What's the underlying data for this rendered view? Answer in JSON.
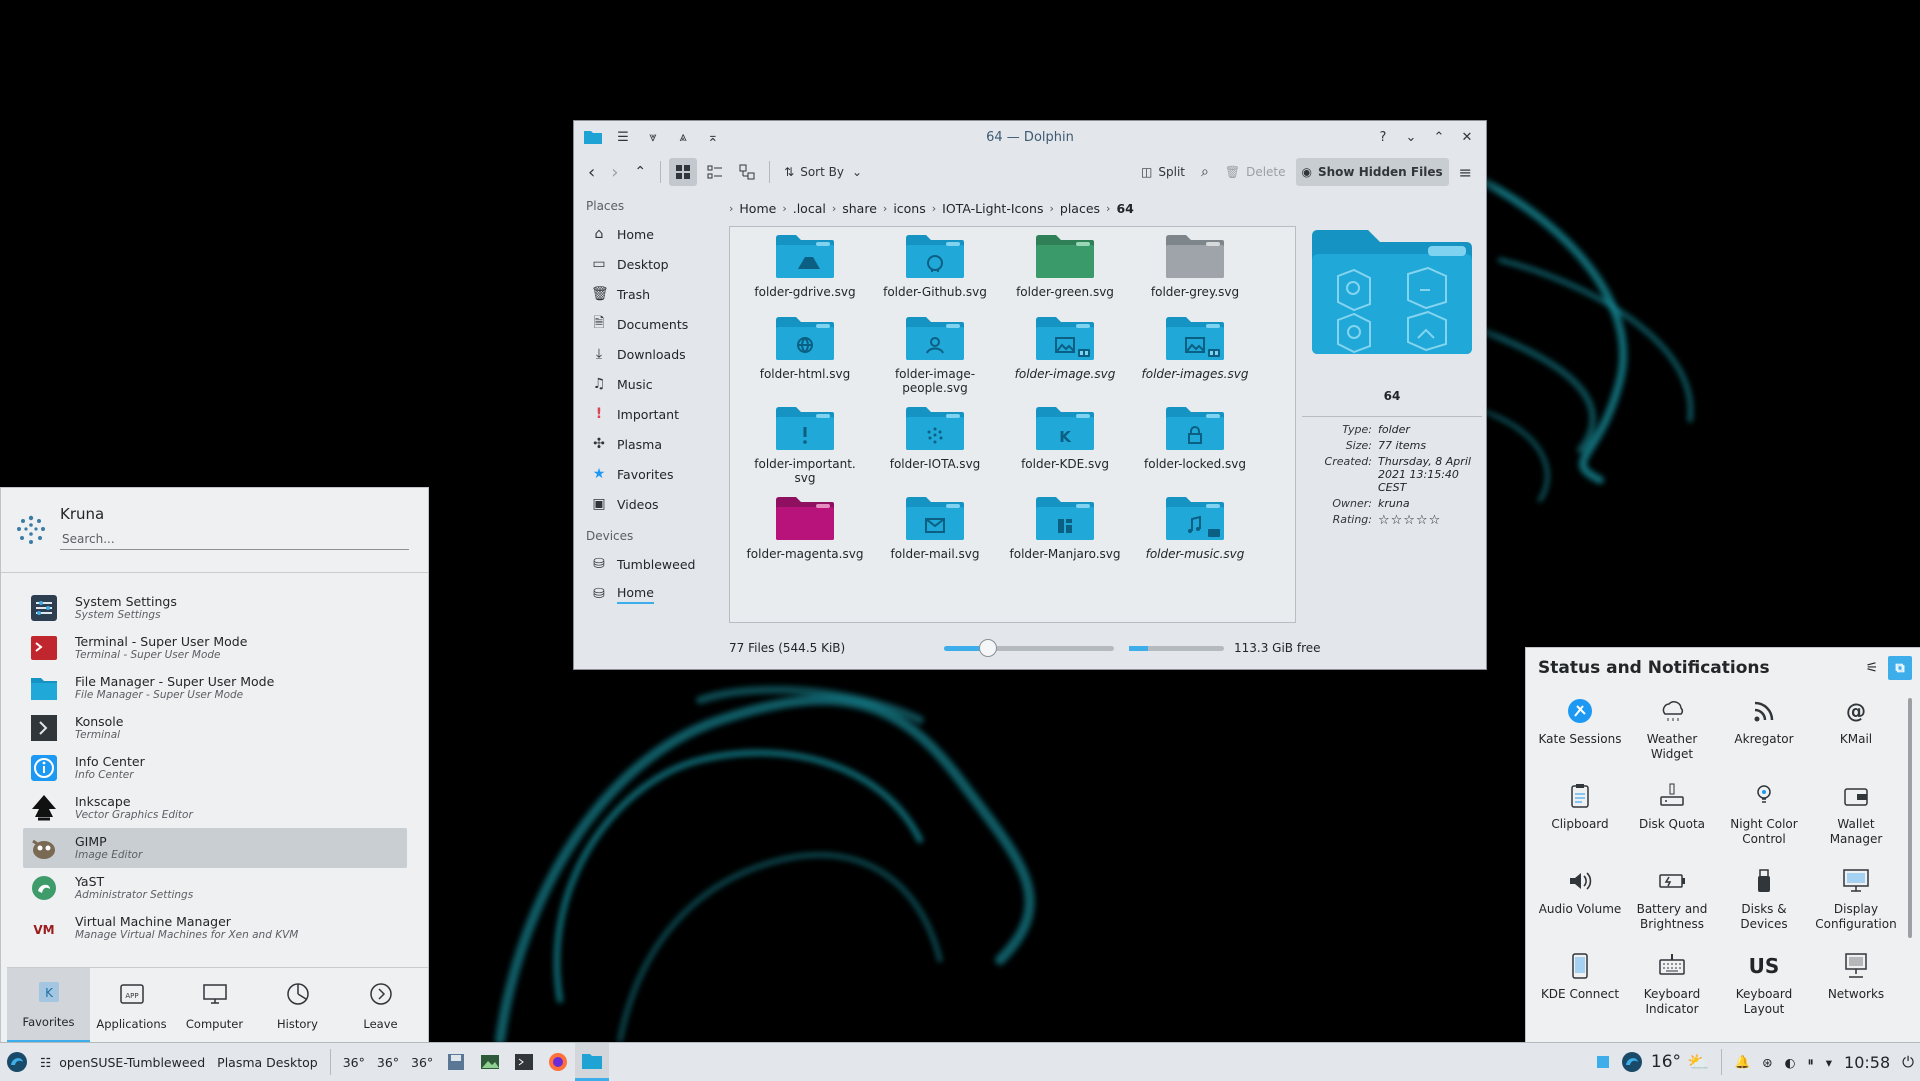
{
  "colors": {
    "accent": "#3daee9",
    "folder_blue": "#1fa3d4",
    "folder_green": "#3a9a6a",
    "folder_grey": "#9ea4aa",
    "folder_magenta": "#b8137b"
  },
  "dolphin": {
    "title": "64 — Dolphin",
    "toolbar": {
      "sort_by": "Sort By",
      "split": "Split",
      "delete": "Delete",
      "show_hidden": "Show Hidden Files"
    },
    "places_header": "Places",
    "places": [
      {
        "label": "Home",
        "icon": "home-icon"
      },
      {
        "label": "Desktop",
        "icon": "desktop-icon"
      },
      {
        "label": "Trash",
        "icon": "trash-icon"
      },
      {
        "label": "Documents",
        "icon": "documents-icon"
      },
      {
        "label": "Downloads",
        "icon": "downloads-icon"
      },
      {
        "label": "Music",
        "icon": "music-icon"
      },
      {
        "label": "Important",
        "icon": "important-icon"
      },
      {
        "label": "Plasma",
        "icon": "plasma-icon"
      },
      {
        "label": "Favorites",
        "icon": "star-icon"
      },
      {
        "label": "Videos",
        "icon": "videos-icon"
      }
    ],
    "devices_header": "Devices",
    "devices": [
      {
        "label": "Tumbleweed",
        "icon": "drive-icon"
      },
      {
        "label": "Home",
        "icon": "drive-icon"
      }
    ],
    "breadcrumb": [
      "Home",
      ".local",
      "share",
      "icons",
      "IOTA-Light-Icons",
      "places",
      "64"
    ],
    "files": [
      {
        "name": "folder-gdrive.svg",
        "italic": false,
        "color": "blue",
        "glyph": "gdrive"
      },
      {
        "name": "folder-Github.svg",
        "italic": false,
        "color": "blue",
        "glyph": "github"
      },
      {
        "name": "folder-green.svg",
        "italic": false,
        "color": "green",
        "glyph": ""
      },
      {
        "name": "folder-grey.svg",
        "italic": false,
        "color": "grey",
        "glyph": ""
      },
      {
        "name": "folder-html.svg",
        "italic": false,
        "color": "blue",
        "glyph": "globe"
      },
      {
        "name": "folder-image-\npeople.svg",
        "italic": false,
        "color": "blue",
        "glyph": "person"
      },
      {
        "name": "folder-image.svg",
        "italic": true,
        "color": "blue",
        "glyph": "image"
      },
      {
        "name": "folder-images.svg",
        "italic": true,
        "color": "blue",
        "glyph": "image"
      },
      {
        "name": "folder-important.\nsvg",
        "italic": false,
        "color": "blue",
        "glyph": "important"
      },
      {
        "name": "folder-IOTA.svg",
        "italic": false,
        "color": "blue",
        "glyph": "iota"
      },
      {
        "name": "folder-KDE.svg",
        "italic": false,
        "color": "blue",
        "glyph": "kde"
      },
      {
        "name": "folder-locked.svg",
        "italic": false,
        "color": "blue",
        "glyph": "lock"
      },
      {
        "name": "folder-magenta.svg",
        "italic": false,
        "color": "magenta",
        "glyph": ""
      },
      {
        "name": "folder-mail.svg",
        "italic": false,
        "color": "blue",
        "glyph": "mail"
      },
      {
        "name": "folder-Manjaro.svg",
        "italic": false,
        "color": "blue",
        "glyph": "manjaro"
      },
      {
        "name": "folder-music.svg",
        "italic": true,
        "color": "blue",
        "glyph": "music"
      }
    ],
    "info": {
      "name": "64",
      "rows": [
        {
          "key": "Type:",
          "value": "folder"
        },
        {
          "key": "Size:",
          "value": "77 items"
        },
        {
          "key": "Created:",
          "value": "Thursday, 8 April 2021 13:15:40 CEST"
        },
        {
          "key": "Owner:",
          "value": "kruna"
        },
        {
          "key": "Rating:",
          "value": "☆☆☆☆☆"
        }
      ]
    },
    "status": {
      "files": "77 Files (544.5 KiB)",
      "free": "113.3 GiB free",
      "zoom_fraction": 0.25,
      "used_fraction": 0.2
    }
  },
  "launcher": {
    "user": "Kruna",
    "search_placeholder": "Search...",
    "apps": [
      {
        "name": "System Settings",
        "desc": "System Settings",
        "icon": "settings-icon"
      },
      {
        "name": "Terminal - Super User Mode",
        "desc": "Terminal - Super User Mode",
        "icon": "terminal-root-icon"
      },
      {
        "name": "File Manager - Super User Mode",
        "desc": "File Manager - Super User Mode",
        "icon": "folder-icon"
      },
      {
        "name": "Konsole",
        "desc": "Terminal",
        "icon": "konsole-icon"
      },
      {
        "name": "Info Center",
        "desc": "Info Center",
        "icon": "info-icon"
      },
      {
        "name": "Inkscape",
        "desc": "Vector Graphics Editor",
        "icon": "inkscape-icon"
      },
      {
        "name": "GIMP",
        "desc": "Image Editor",
        "icon": "gimp-icon"
      },
      {
        "name": "YaST",
        "desc": "Administrator Settings",
        "icon": "yast-icon"
      },
      {
        "name": "Virtual Machine Manager",
        "desc": "Manage Virtual Machines for Xen and KVM",
        "icon": "vm-icon"
      }
    ],
    "selected_index": 6,
    "tabs": [
      {
        "label": "Favorites",
        "icon": "favorites-icon"
      },
      {
        "label": "Applications",
        "icon": "applications-icon"
      },
      {
        "label": "Computer",
        "icon": "computer-icon"
      },
      {
        "label": "History",
        "icon": "history-icon"
      },
      {
        "label": "Leave",
        "icon": "leave-icon"
      }
    ]
  },
  "tray": {
    "title": "Status and Notifications",
    "items": [
      {
        "label": "Kate Sessions",
        "icon": "kate-icon"
      },
      {
        "label": "Weather\nWidget",
        "icon": "weather-icon"
      },
      {
        "label": "Akregator",
        "icon": "rss-icon"
      },
      {
        "label": "KMail",
        "icon": "at-icon"
      },
      {
        "label": "Clipboard",
        "icon": "clipboard-icon"
      },
      {
        "label": "Disk Quota",
        "icon": "disk-quota-icon"
      },
      {
        "label": "Night Color\nControl",
        "icon": "night-color-icon"
      },
      {
        "label": "Wallet Manager",
        "icon": "wallet-icon"
      },
      {
        "label": "Audio Volume",
        "icon": "volume-icon"
      },
      {
        "label": "Battery and\nBrightness",
        "icon": "battery-icon"
      },
      {
        "label": "Disks & Devices",
        "icon": "usb-icon"
      },
      {
        "label": "Display\nConfiguration",
        "icon": "display-icon"
      },
      {
        "label": "KDE Connect",
        "icon": "phone-icon"
      },
      {
        "label": "Keyboard\nIndicator",
        "icon": "keyboard-icon"
      },
      {
        "label": "Keyboard\nLayout",
        "icon": "us-layout-icon",
        "glyph": "US"
      },
      {
        "label": "Networks",
        "icon": "network-icon"
      }
    ]
  },
  "taskbar": {
    "distro": "openSUSE-Tumbleweed",
    "activity": "Plasma Desktop",
    "temps": [
      "36°",
      "36°",
      "36°"
    ],
    "weather": "16°",
    "clock": "10:58"
  }
}
